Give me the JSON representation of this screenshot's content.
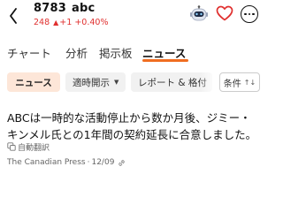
{
  "header": {
    "code": "8783",
    "name": "abc",
    "price": "248",
    "change": "+1",
    "change_pct": "+0.40%",
    "quote_color": "#e0302f"
  },
  "tabs": [
    {
      "label": "チャート",
      "active": false
    },
    {
      "label": "分析",
      "active": false
    },
    {
      "label": "掲示板",
      "active": false
    },
    {
      "label": "ニュース",
      "active": true
    }
  ],
  "filters": {
    "news": "ニュース",
    "period": "適時開示",
    "report": "レポート & 格付",
    "conditions": "条件"
  },
  "article": {
    "text": "ABCは一時的な活動停止から数か月後、ジミー・キンメル氏との1年間の契約延長に合意しました。",
    "auto_translate": "自動翻訳",
    "source": "The Canadian Press",
    "date": "12/09"
  },
  "accent_color": "#f06d20"
}
